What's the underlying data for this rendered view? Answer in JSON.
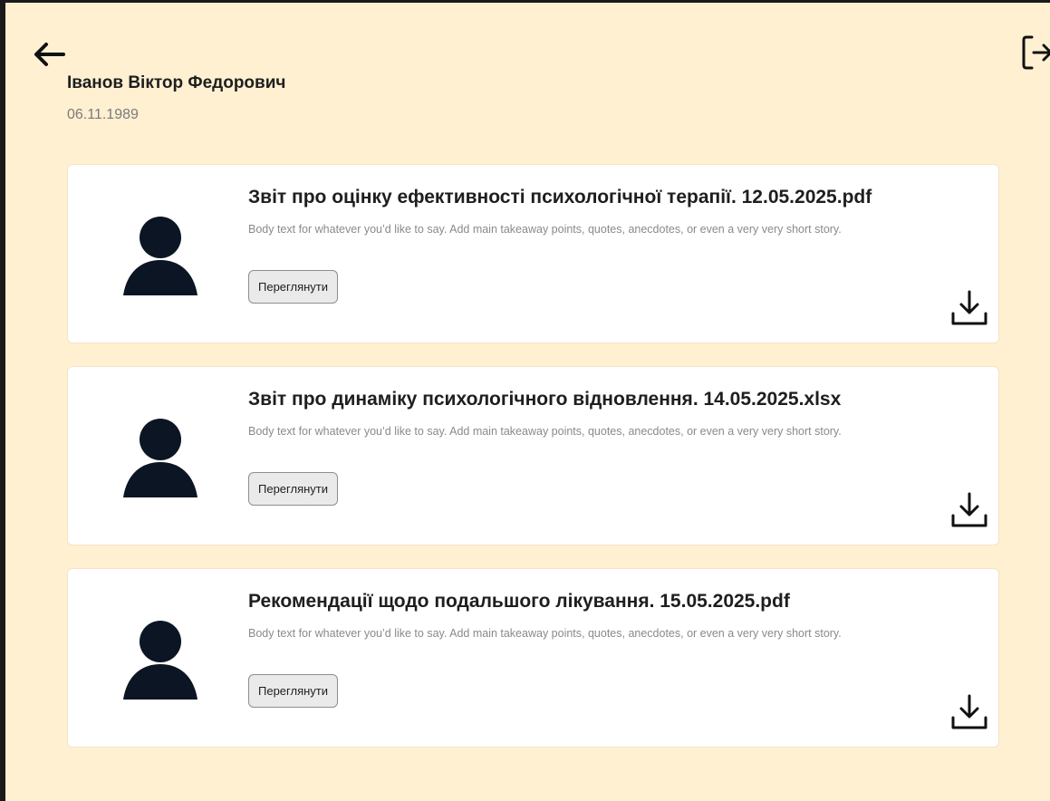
{
  "header": {
    "back_icon": "arrow-left-icon",
    "logout_icon": "logout-icon",
    "person_name": "Іванов Віктор Федорович",
    "person_dob": "06.11.1989"
  },
  "documents": [
    {
      "title": "Звіт про оцінку ефективності психологічної терапії. 12.05.2025.pdf",
      "body": "Body text for whatever you’d like to say. Add main takeaway points, quotes, anecdotes, or even a very very short story.",
      "view_label": "Переглянути",
      "avatar_icon": "user-avatar-icon",
      "download_icon": "download-icon"
    },
    {
      "title": "Звіт про динаміку психологічного відновлення. 14.05.2025.xlsx",
      "body": "Body text for whatever you’d like to say. Add main takeaway points, quotes, anecdotes, or even a very very short story.",
      "view_label": "Переглянути",
      "avatar_icon": "user-avatar-icon",
      "download_icon": "download-icon"
    },
    {
      "title": "Рекомендації щодо подальшого лікування. 15.05.2025.pdf",
      "body": "Body text for whatever you’d like to say. Add main takeaway points, quotes, anecdotes, or even a very very short story.",
      "view_label": "Переглянути",
      "avatar_icon": "user-avatar-icon",
      "download_icon": "download-icon"
    }
  ],
  "colors": {
    "page_background": "#fff0d2",
    "card_background": "#ffffff",
    "avatar": "#0b1523",
    "frame_border": "#1a1a1a"
  }
}
